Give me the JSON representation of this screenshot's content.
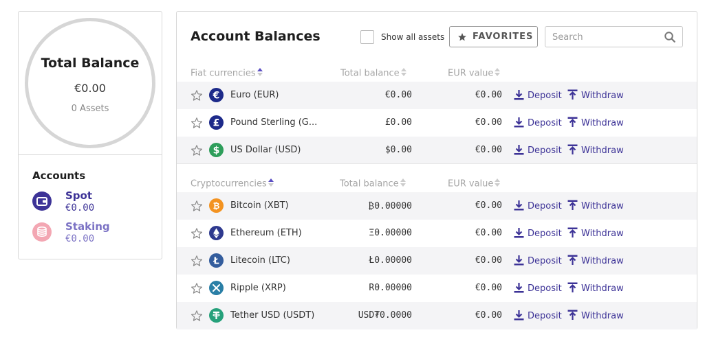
{
  "summary": {
    "title": "Total Balance",
    "amount": "€0.00",
    "assets_count": "0",
    "assets_label": "Assets"
  },
  "accounts": {
    "title": "Accounts",
    "items": [
      {
        "name": "Spot",
        "value": "€0.00",
        "color": "#3d3397",
        "icon": "wallet-icon"
      },
      {
        "name": "Staking",
        "value": "€0.00",
        "color": "#7b72c4",
        "icon": "coin-stack-icon"
      }
    ]
  },
  "balances": {
    "title": "Account Balances",
    "show_all_label": "Show all assets",
    "favorites_label": "FAVORITES",
    "search_placeholder": "Search",
    "fiat_headers": {
      "name": "Fiat currencies",
      "balance": "Total balance",
      "eur": "EUR value"
    },
    "crypto_headers": {
      "name": "Cryptocurrencies",
      "balance": "Total balance",
      "eur": "EUR value"
    },
    "deposit_label": "Deposit",
    "withdraw_label": "Withdraw",
    "fiat": [
      {
        "name": "Euro (EUR)",
        "balance": "€0.00",
        "eur": "€0.00",
        "icon": "euro-icon",
        "color": "#1d2a8a"
      },
      {
        "name": "Pound Sterling (G...",
        "balance": "£0.00",
        "eur": "€0.00",
        "icon": "pound-icon",
        "color": "#1d2a8a"
      },
      {
        "name": "US Dollar (USD)",
        "balance": "$0.00",
        "eur": "€0.00",
        "icon": "dollar-icon",
        "color": "#2e9e5b"
      }
    ],
    "crypto": [
      {
        "name": "Bitcoin (XBT)",
        "balance": "₿0.00000",
        "eur": "€0.00",
        "icon": "bitcoin-icon",
        "color": "#f39321"
      },
      {
        "name": "Ethereum (ETH)",
        "balance": "Ξ0.00000",
        "eur": "€0.00",
        "icon": "ethereum-icon",
        "color": "#2f3a8f"
      },
      {
        "name": "Litecoin (LTC)",
        "balance": "Ł0.00000",
        "eur": "€0.00",
        "icon": "litecoin-icon",
        "color": "#345d9d"
      },
      {
        "name": "Ripple (XRP)",
        "balance": "R0.00000",
        "eur": "€0.00",
        "icon": "ripple-icon",
        "color": "#2a7fa6"
      },
      {
        "name": "Tether USD (USDT)",
        "balance": "USD₮0.0000",
        "eur": "€0.00",
        "icon": "tether-icon",
        "color": "#26a17b"
      }
    ]
  },
  "colors": {
    "accent": "#3d3397",
    "row_alt": "#f4f4f6",
    "border": "#d8d8d8"
  }
}
